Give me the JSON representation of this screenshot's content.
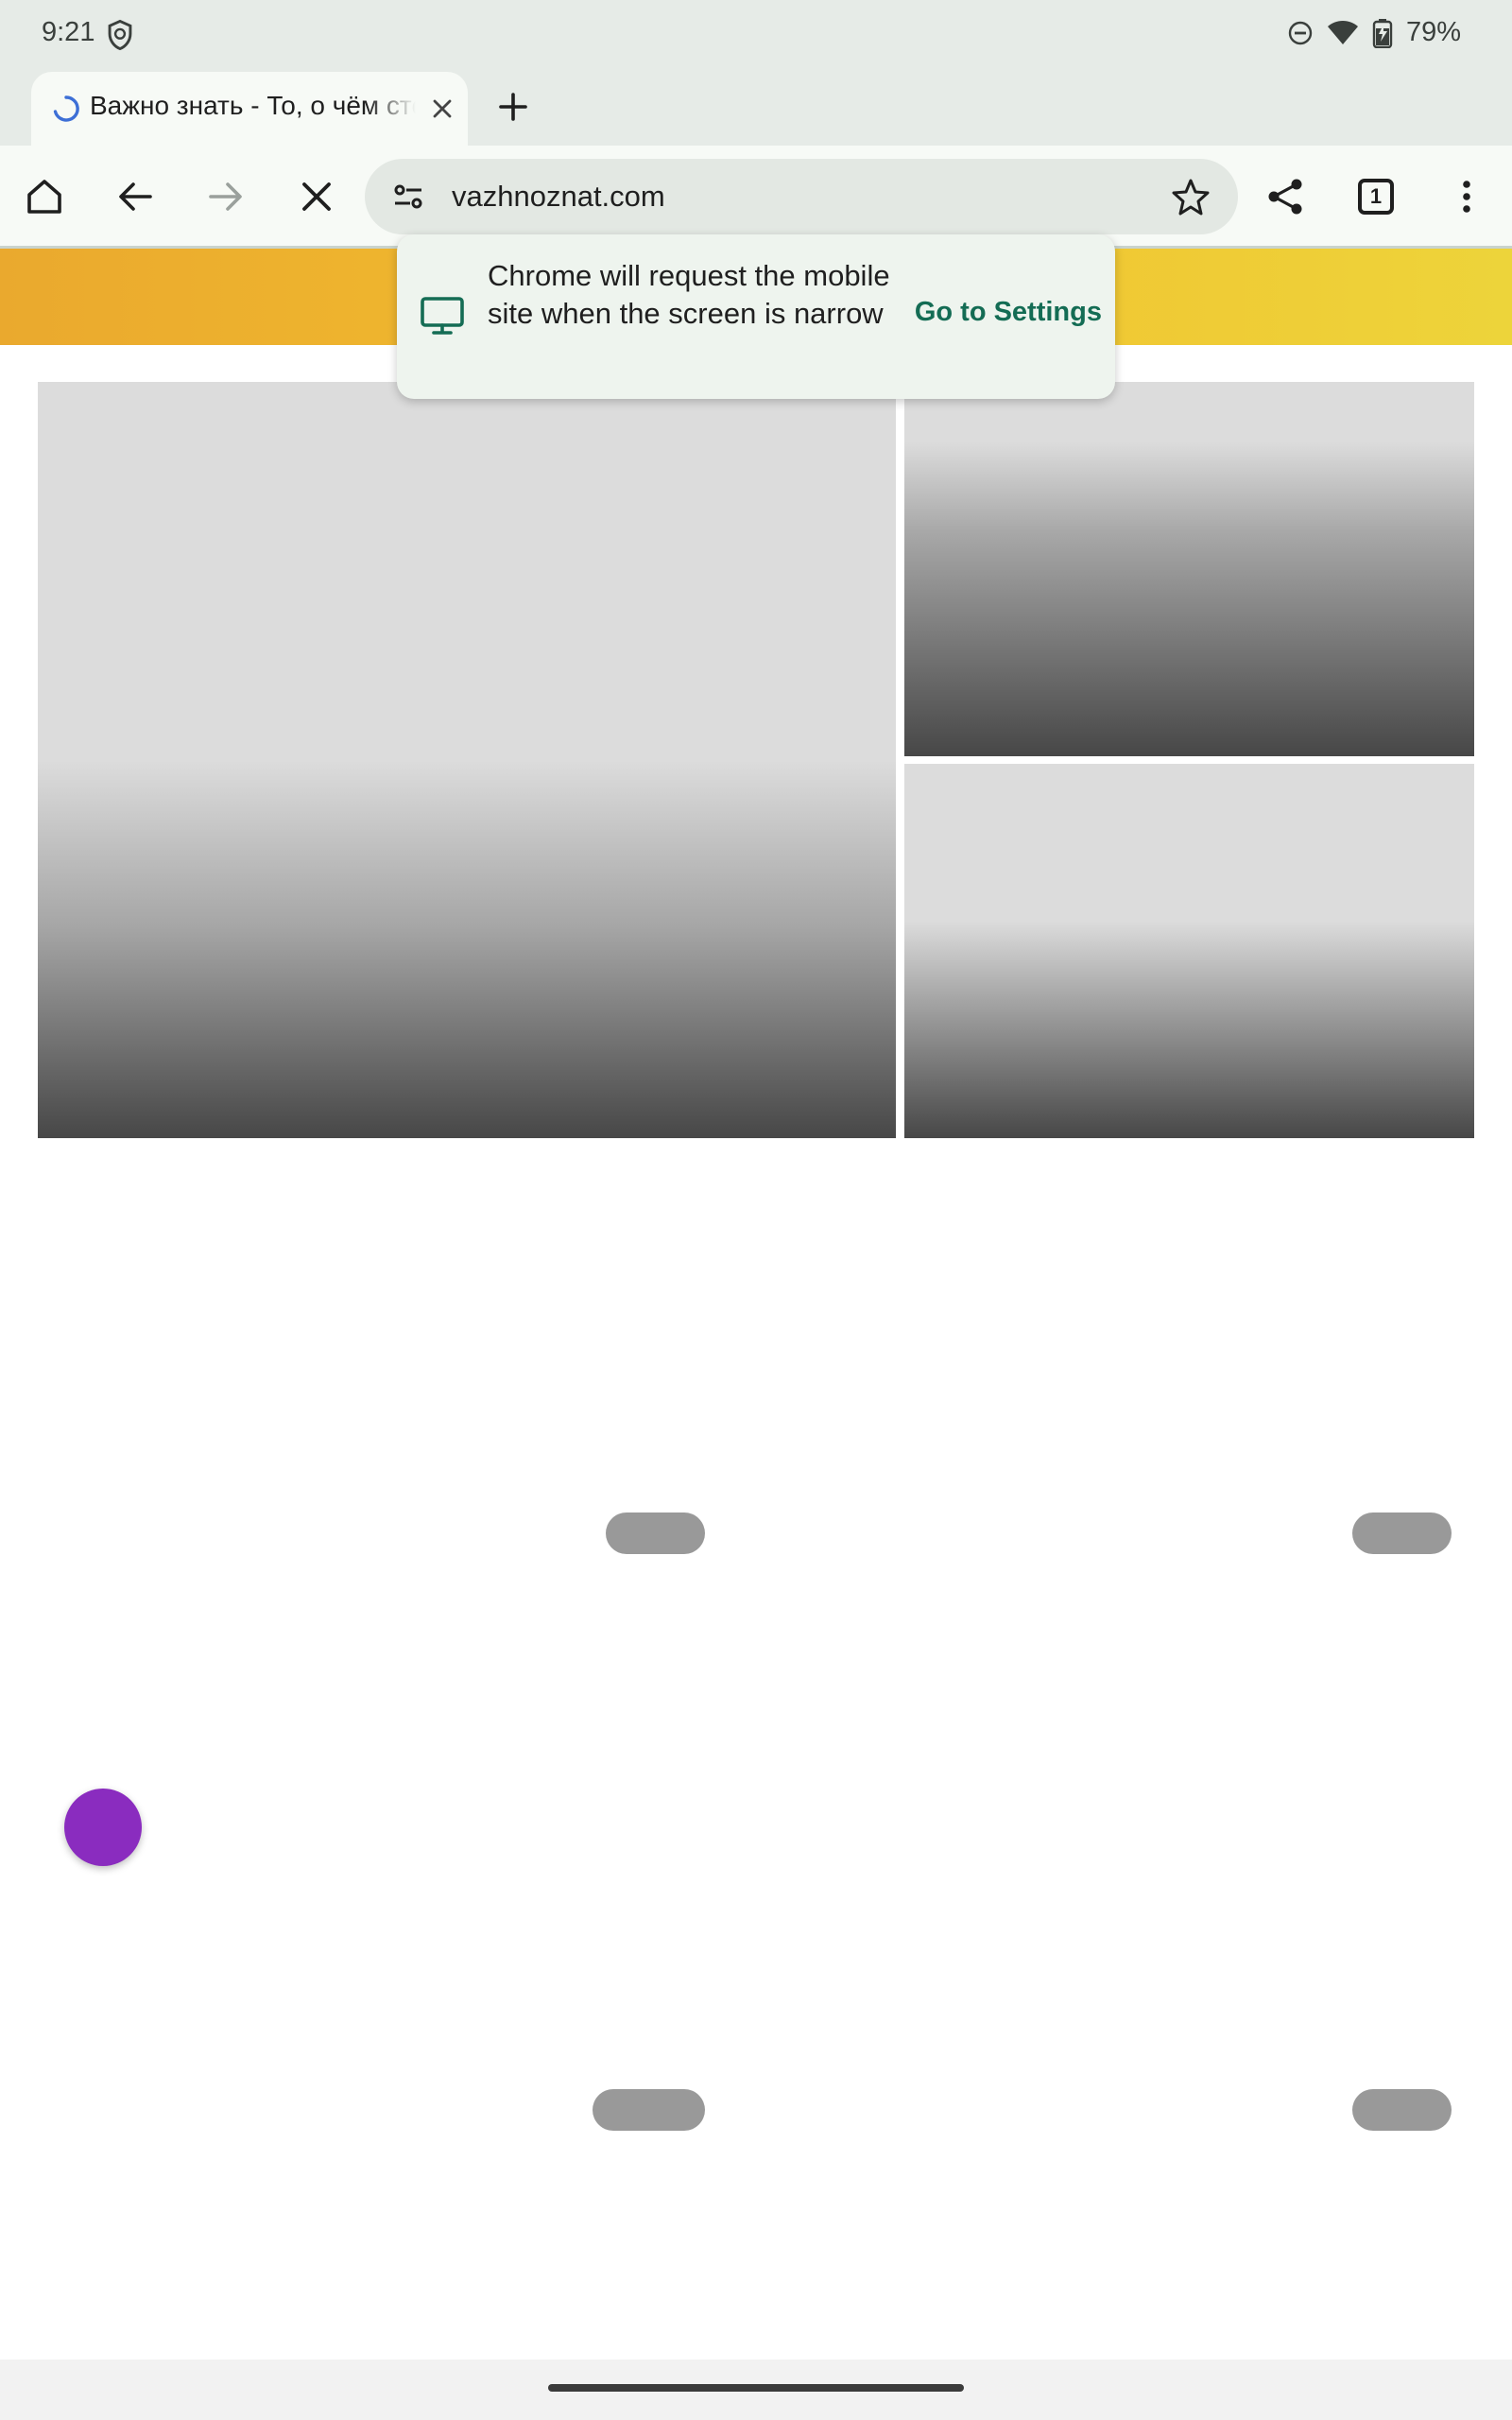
{
  "status_bar": {
    "time": "9:21",
    "battery": "79%",
    "icons": [
      "shield-icon",
      "do-not-disturb-icon",
      "wifi-icon",
      "battery-icon"
    ]
  },
  "tab": {
    "title": "Важно знать - То, о чём стоит знать",
    "close_icon": "close-icon",
    "loading": true
  },
  "new_tab_icon": "plus-icon",
  "toolbar": {
    "home_icon": "home-icon",
    "back_icon": "arrow-back-icon",
    "forward_icon": "arrow-forward-icon",
    "stop_icon": "close-icon",
    "share_icon": "share-icon",
    "menu_icon": "more-vert-icon",
    "tab_count": "1"
  },
  "omnibox": {
    "url": "vazhnoznat.com",
    "site_info_icon": "tune-icon",
    "bookmark_icon": "star-outline-icon"
  },
  "infobar": {
    "icon": "desktop-icon",
    "message": "Chrome will request the mobile site when the screen is narrow",
    "action": "Go to Settings"
  },
  "colors": {
    "header_gradient_start": "#eaa92e",
    "header_gradient_end": "#edd43a",
    "link_green": "#146c54",
    "fab_purple": "#8a2cbf",
    "chrome_surface": "#f7faf6"
  }
}
